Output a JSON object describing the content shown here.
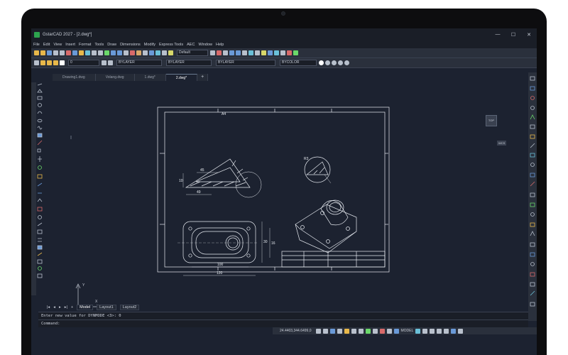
{
  "app": {
    "title": "GstarCAD 2027 - [2.dwg*]"
  },
  "window_buttons": {
    "minimize": "—",
    "maximize": "☐",
    "close": "✕"
  },
  "menu": [
    "File",
    "Edit",
    "View",
    "Insert",
    "Format",
    "Tools",
    "Draw",
    "Dimensions",
    "Modify",
    "Express Tools",
    "AEC",
    "Window",
    "Help"
  ],
  "toolbar": {
    "text_style": "Default",
    "layer_value": "0",
    "color": "BYLAYER",
    "linetype": "BYLAYER",
    "lineweight": "BYLAYER",
    "plot_color": "BYCOLOR"
  },
  "tabs": [
    {
      "label": "Drawing1.dwg"
    },
    {
      "label": "Volang.dwg"
    },
    {
      "label": "1.dwg*"
    },
    {
      "label": "2.dwg*"
    },
    {
      "label": "+"
    }
  ],
  "drawing": {
    "dims": {
      "d45": "45",
      "d10": "10",
      "d49": "49",
      "r3": "R3",
      "d100": "100",
      "d120": "120",
      "d30": "30",
      "d16": "16"
    },
    "title_block_note": "A4"
  },
  "viewcube": {
    "label": "TOP"
  },
  "wcs_label": "WCS",
  "ucs": {
    "x_label": "X",
    "y_label": "Y"
  },
  "layout_tabs": {
    "nav": [
      "|◂",
      "◂",
      "▸",
      "▸|",
      "+"
    ],
    "items": [
      "Model",
      "Layout1",
      "Layout2"
    ]
  },
  "command": {
    "history": "Enter new value for DYNMODE <3>: 0",
    "prompt": "Command:"
  },
  "status": {
    "coords": "24.4403,344.6499,0",
    "model": "MODEL"
  },
  "colors": {
    "accent": "#2da44e",
    "bg": "#1c2230",
    "line": "#e8ecf2"
  }
}
